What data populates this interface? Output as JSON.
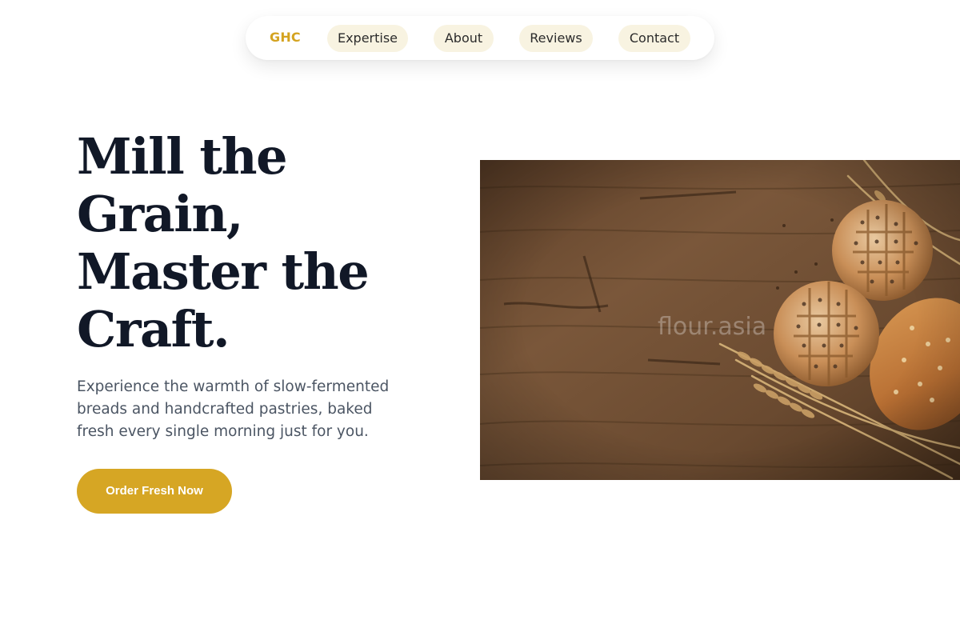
{
  "nav": {
    "brand": "GHC",
    "links": [
      "Expertise",
      "About",
      "Reviews",
      "Contact"
    ]
  },
  "hero": {
    "title_lines": [
      "Mill the",
      "Grain,",
      "Master the",
      "Craft."
    ],
    "subtitle_lines": [
      "Experience the warmth of slow-fermented",
      "breads and handcrafted pastries, baked",
      "fresh every single morning just for you."
    ],
    "cta_label": "Order Fresh Now",
    "image_watermark": "flour.asia"
  },
  "colors": {
    "accent": "#d6a624",
    "brand": "#d4a320",
    "heading": "#111827",
    "body_text": "#4b5563",
    "pill_bg": "#f8f3e1"
  }
}
